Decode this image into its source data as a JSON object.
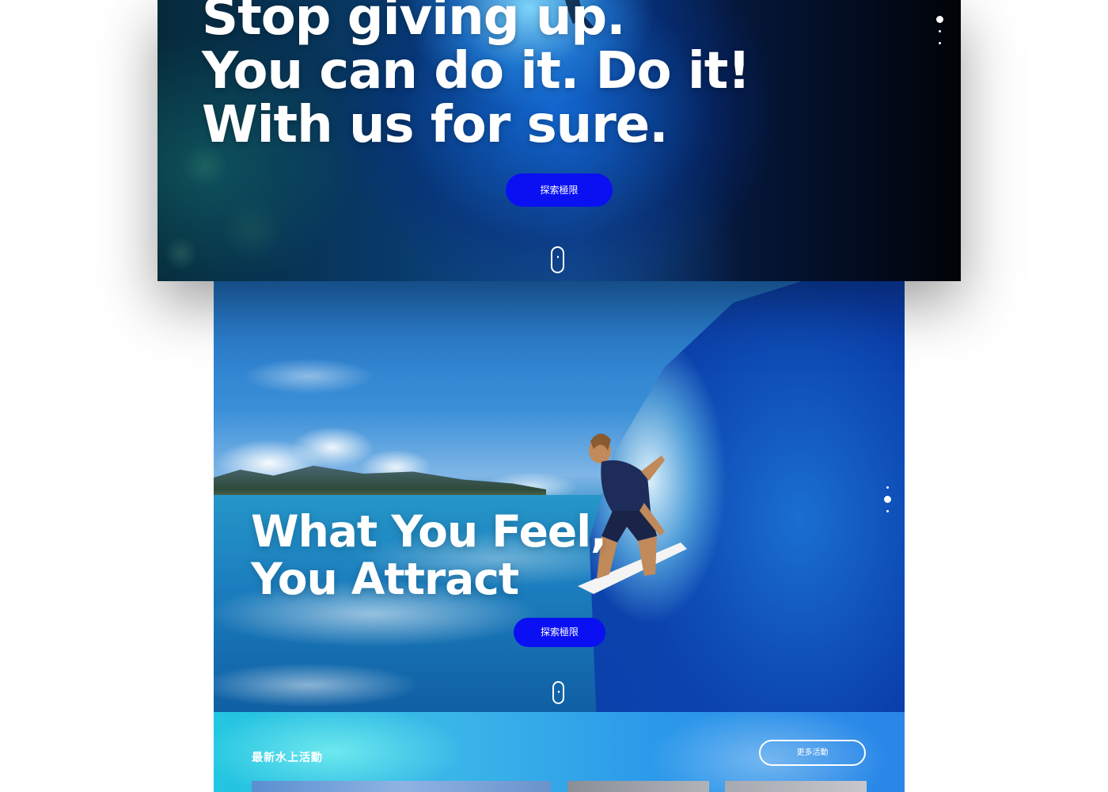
{
  "hero_underwater": {
    "title_lines": [
      "Stop giving up.",
      "You can do it. Do it!",
      "With us for sure."
    ],
    "cta_label": "探索極限",
    "dots_active_index": 0
  },
  "hero_surf": {
    "title_lines": [
      "What You Feel,",
      "You Attract"
    ],
    "cta_label": "探索極限",
    "dots_active_index": 1
  },
  "activities": {
    "section_title": "最新水上活動",
    "more_label": "更多活動"
  },
  "colors": {
    "cta_blue": "#0a10f2",
    "text_white": "#ffffff"
  },
  "icons": [
    "scroll-mouse-icon",
    "dot-nav-icon"
  ]
}
